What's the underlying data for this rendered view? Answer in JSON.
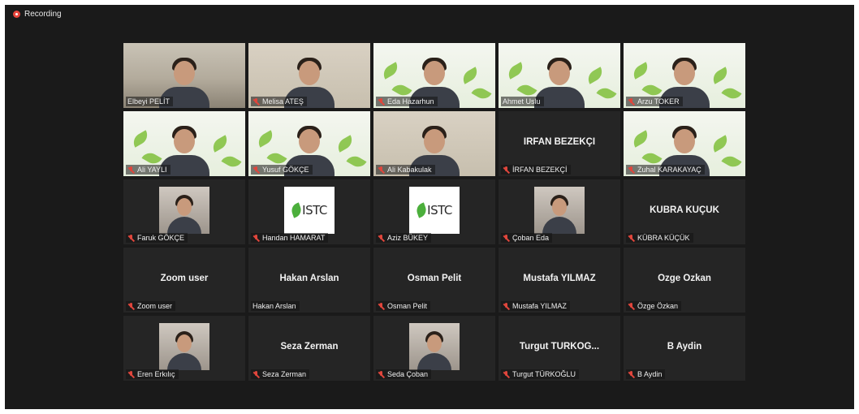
{
  "recording": {
    "label": "Recording",
    "indicator_color": "#e8453c"
  },
  "accent_active_speaker": "#b8e65a",
  "participants": [
    {
      "label": "Elbeyi PELİT",
      "view": "video",
      "scene": "office",
      "muted": false,
      "active": true
    },
    {
      "label": "Melisa ATEŞ",
      "view": "video",
      "scene": "wall",
      "muted": true
    },
    {
      "label": "Eda Hazarhun",
      "view": "video",
      "scene": "banner",
      "muted": true
    },
    {
      "label": "Ahmet Uslu",
      "view": "video",
      "scene": "banner",
      "muted": false
    },
    {
      "label": "Arzu TOKER",
      "view": "video",
      "scene": "banner",
      "muted": true
    },
    {
      "label": "Ali YAYLI",
      "view": "video",
      "scene": "banner",
      "muted": true
    },
    {
      "label": "Yusuf GÖKÇE",
      "view": "video",
      "scene": "banner",
      "muted": true
    },
    {
      "label": "Ali Kabakulak",
      "view": "video",
      "scene": "wall",
      "muted": true
    },
    {
      "label": "İRFAN BEZEKÇİ",
      "view": "name",
      "display": "İRFAN BEZEKÇİ",
      "muted": true
    },
    {
      "label": "Zuhal KARAKAYAÇ",
      "view": "video",
      "scene": "banner",
      "muted": true
    },
    {
      "label": "Faruk GÖKÇE",
      "view": "photo",
      "muted": true
    },
    {
      "label": "Handan HAMARAT",
      "view": "logo",
      "logo_text": "ISTC",
      "muted": true
    },
    {
      "label": "Aziz BÜKEY",
      "view": "logo",
      "logo_text": "ISTC",
      "muted": true
    },
    {
      "label": "Çoban Eda",
      "view": "photo",
      "muted": true
    },
    {
      "label": "KÜBRA KÜÇÜK",
      "view": "name",
      "display": "KÜBRA KÜÇÜK",
      "muted": true
    },
    {
      "label": "Zoom user",
      "view": "name",
      "display": "Zoom user",
      "muted": true
    },
    {
      "label": "Hakan Arslan",
      "view": "name",
      "display": "Hakan Arslan",
      "muted": false
    },
    {
      "label": "Osman Pelit",
      "view": "name",
      "display": "Osman Pelit",
      "muted": true
    },
    {
      "label": "Mustafa YILMAZ",
      "view": "name",
      "display": "Mustafa YILMAZ",
      "muted": true
    },
    {
      "label": "Özge Özkan",
      "view": "name",
      "display": "Özge Özkan",
      "muted": true
    },
    {
      "label": "Eren Erkılıç",
      "view": "photo",
      "muted": true
    },
    {
      "label": "Seza Zerman",
      "view": "name",
      "display": "Seza Zerman",
      "muted": true
    },
    {
      "label": "Seda Çoban",
      "view": "photo",
      "muted": true
    },
    {
      "label": "Turgut TÜRKOĞLU",
      "view": "name",
      "display": "Turgut TÜRKOĞ...",
      "muted": true
    },
    {
      "label": "B Aydin",
      "view": "name",
      "display": "B Aydin",
      "muted": true
    }
  ]
}
